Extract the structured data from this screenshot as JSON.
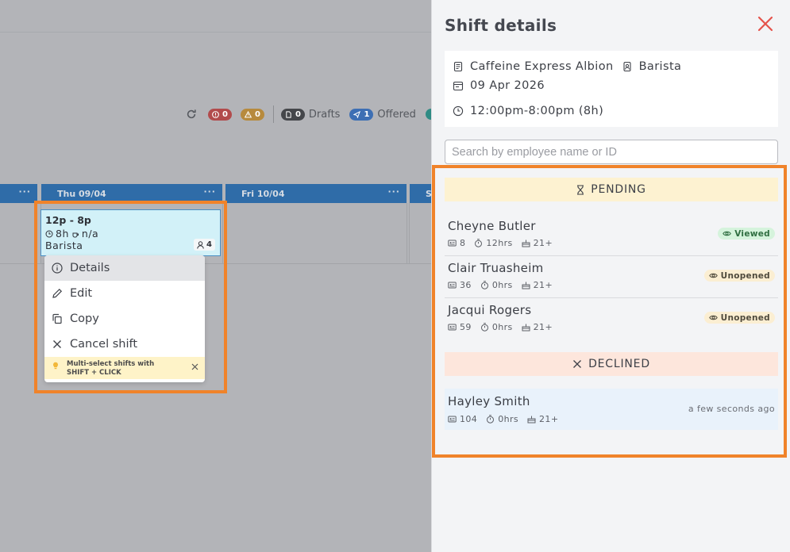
{
  "toolbar": {
    "errors_count": "0",
    "warnings_count": "0",
    "drafts_count": "0",
    "drafts_label": "Drafts",
    "offered_count": "1",
    "offered_label": "Offered"
  },
  "roster": {
    "days": [
      {
        "label": ""
      },
      {
        "label": "Thu 09/04"
      },
      {
        "label": "Fri 10/04"
      },
      {
        "label": "S"
      }
    ],
    "more_label": "···"
  },
  "shift_card": {
    "time": "12p - 8p",
    "duration": "8h",
    "break": "n/a",
    "role": "Barista",
    "staff_count": "4"
  },
  "context_menu": {
    "items": [
      {
        "label": "Details",
        "icon": "info-icon"
      },
      {
        "label": "Edit",
        "icon": "pencil-icon"
      },
      {
        "label": "Copy",
        "icon": "copy-icon"
      },
      {
        "label": "Cancel shift",
        "icon": "close-icon"
      }
    ],
    "tip_line1": "Multi-select shifts with",
    "tip_line2": "SHIFT + CLICK"
  },
  "panel": {
    "title": "Shift details",
    "location": "Caffeine Express Albion",
    "role": "Barista",
    "date": "09 Apr 2026",
    "time_range": "12:00pm-8:00pm (8h)",
    "search_placeholder": "Search by employee name or ID",
    "pending_label": "PENDING",
    "declined_label": "DECLINED",
    "pending": [
      {
        "name": "Cheyne Butler",
        "id": "8",
        "hours": "12hrs",
        "age": "21+",
        "status": "Viewed"
      },
      {
        "name": "Clair Truasheim",
        "id": "36",
        "hours": "0hrs",
        "age": "21+",
        "status": "Unopened"
      },
      {
        "name": "Jacqui Rogers",
        "id": "59",
        "hours": "0hrs",
        "age": "21+",
        "status": "Unopened"
      }
    ],
    "declined": [
      {
        "name": "Hayley Smith",
        "id": "104",
        "hours": "0hrs",
        "age": "21+",
        "when": "a few seconds ago"
      }
    ]
  },
  "colors": {
    "highlight": "#f0832a",
    "day_header": "#2f6ca8",
    "close": "#e5534b",
    "pending_bg": "#fdf2d1",
    "declined_bg": "#fde6dc"
  }
}
